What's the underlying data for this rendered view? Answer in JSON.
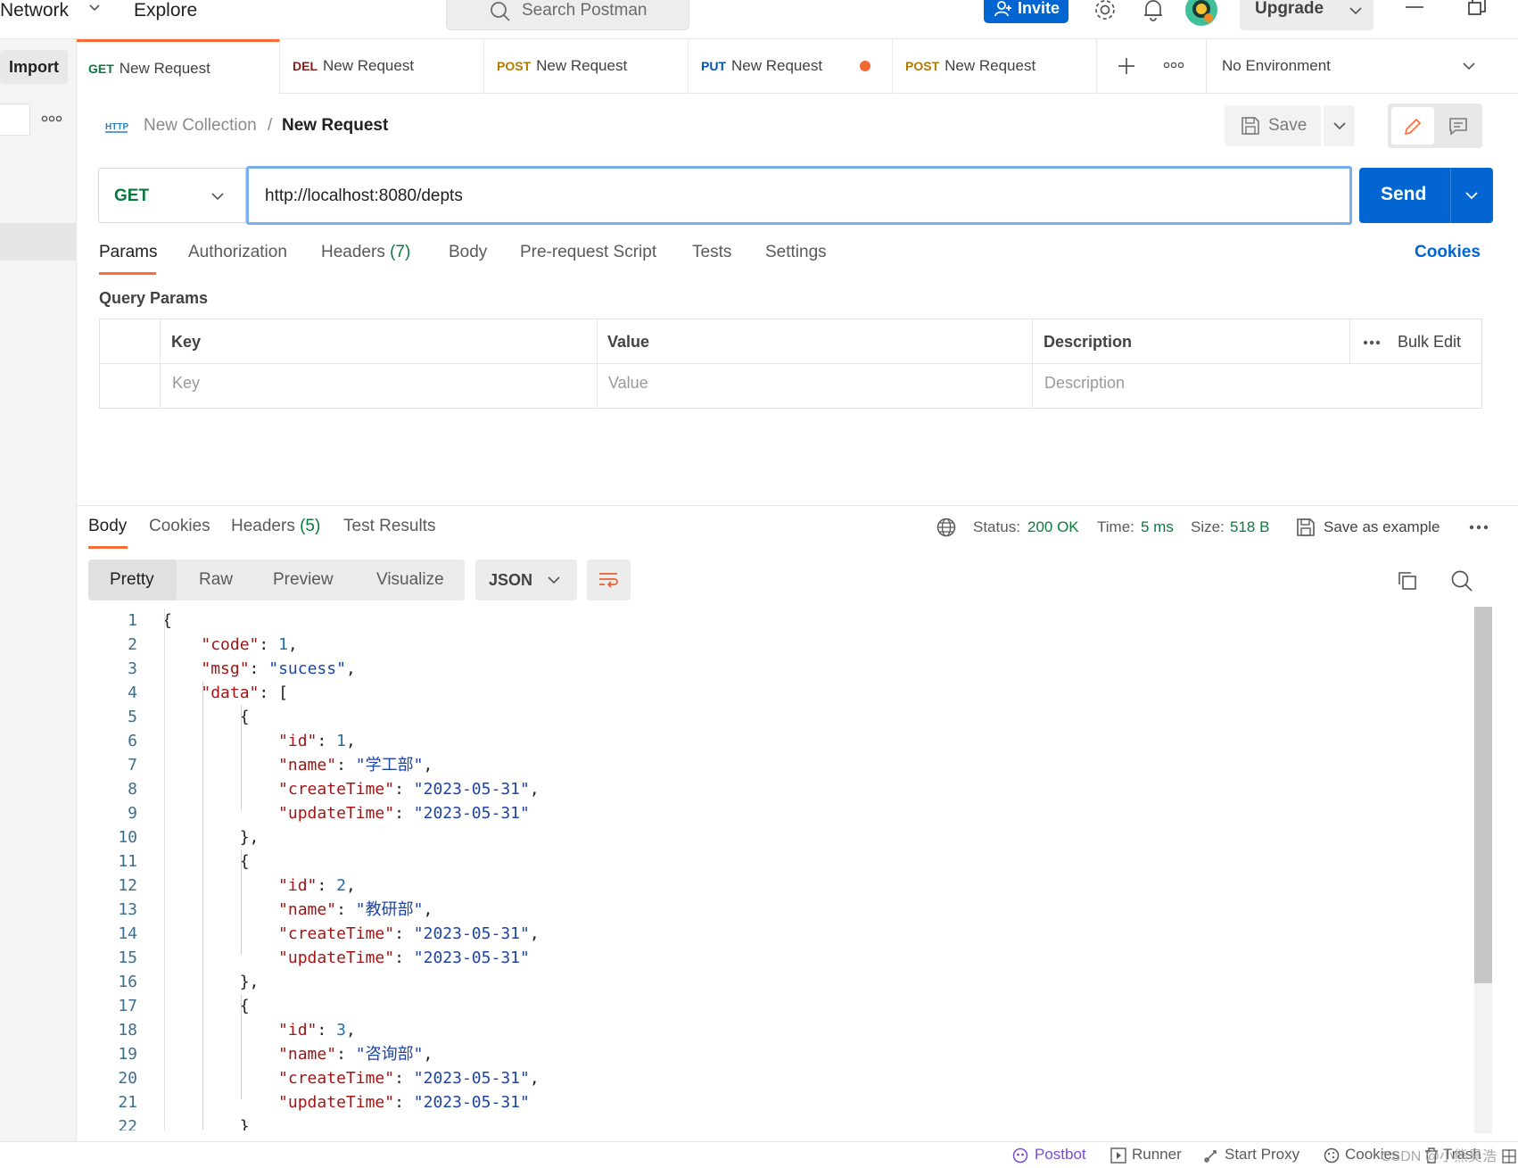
{
  "topbar": {
    "network": "Network",
    "explore": "Explore",
    "search_placeholder": "Search Postman",
    "invite": "Invite",
    "upgrade": "Upgrade"
  },
  "sidebar": {
    "import": "Import"
  },
  "tabs": [
    {
      "method": "GET",
      "method_color": "#0b7a3e",
      "label": "New Request",
      "active": true
    },
    {
      "method": "DEL",
      "method_color": "#8b1d1d",
      "label": "New Request"
    },
    {
      "method": "POST",
      "method_color": "#ad7a03",
      "label": "New Request"
    },
    {
      "method": "PUT",
      "method_color": "#0053b8",
      "label": "New Request"
    },
    {
      "method": "POST",
      "method_color": "#ad7a03",
      "label": "New Request"
    }
  ],
  "environment": "No Environment",
  "breadcrumb": {
    "collection": "New Collection",
    "separator": "/",
    "request": "New Request"
  },
  "save_label": "Save",
  "request": {
    "method": "GET",
    "url": "http://localhost:8080/depts",
    "send_label": "Send"
  },
  "request_tabs": {
    "params": "Params",
    "authorization": "Authorization",
    "headers": "Headers",
    "headers_count": "(7)",
    "body": "Body",
    "prerequest": "Pre-request Script",
    "tests": "Tests",
    "settings": "Settings",
    "cookies": "Cookies"
  },
  "query_params": {
    "title": "Query Params",
    "headers": {
      "key": "Key",
      "value": "Value",
      "description": "Description",
      "bulk_edit": "Bulk Edit"
    },
    "placeholders": {
      "key": "Key",
      "value": "Value",
      "description": "Description"
    }
  },
  "response": {
    "tabs": {
      "body": "Body",
      "cookies": "Cookies",
      "headers": "Headers",
      "headers_count": "(5)",
      "test_results": "Test Results"
    },
    "status_label": "Status:",
    "status": "200 OK",
    "time_label": "Time:",
    "time": "5 ms",
    "size_label": "Size:",
    "size": "518 B",
    "save_example": "Save as example",
    "views": {
      "pretty": "Pretty",
      "raw": "Raw",
      "preview": "Preview",
      "visualize": "Visualize"
    },
    "format": "JSON"
  },
  "code_lines": [
    [
      {
        "t": "p",
        "v": "{"
      }
    ],
    [
      {
        "t": "p",
        "v": "    "
      },
      {
        "t": "k",
        "v": "\"code\""
      },
      {
        "t": "p",
        "v": ": "
      },
      {
        "t": "n",
        "v": "1"
      },
      {
        "t": "p",
        "v": ","
      }
    ],
    [
      {
        "t": "p",
        "v": "    "
      },
      {
        "t": "k",
        "v": "\"msg\""
      },
      {
        "t": "p",
        "v": ": "
      },
      {
        "t": "s",
        "v": "\"sucess\""
      },
      {
        "t": "p",
        "v": ","
      }
    ],
    [
      {
        "t": "p",
        "v": "    "
      },
      {
        "t": "k",
        "v": "\"data\""
      },
      {
        "t": "p",
        "v": ": ["
      }
    ],
    [
      {
        "t": "p",
        "v": "        {"
      }
    ],
    [
      {
        "t": "p",
        "v": "            "
      },
      {
        "t": "k",
        "v": "\"id\""
      },
      {
        "t": "p",
        "v": ": "
      },
      {
        "t": "n",
        "v": "1"
      },
      {
        "t": "p",
        "v": ","
      }
    ],
    [
      {
        "t": "p",
        "v": "            "
      },
      {
        "t": "k",
        "v": "\"name\""
      },
      {
        "t": "p",
        "v": ": "
      },
      {
        "t": "s",
        "v": "\"学工部\""
      },
      {
        "t": "p",
        "v": ","
      }
    ],
    [
      {
        "t": "p",
        "v": "            "
      },
      {
        "t": "k",
        "v": "\"createTime\""
      },
      {
        "t": "p",
        "v": ": "
      },
      {
        "t": "s",
        "v": "\"2023-05-31\""
      },
      {
        "t": "p",
        "v": ","
      }
    ],
    [
      {
        "t": "p",
        "v": "            "
      },
      {
        "t": "k",
        "v": "\"updateTime\""
      },
      {
        "t": "p",
        "v": ": "
      },
      {
        "t": "s",
        "v": "\"2023-05-31\""
      }
    ],
    [
      {
        "t": "p",
        "v": "        },"
      }
    ],
    [
      {
        "t": "p",
        "v": "        {"
      }
    ],
    [
      {
        "t": "p",
        "v": "            "
      },
      {
        "t": "k",
        "v": "\"id\""
      },
      {
        "t": "p",
        "v": ": "
      },
      {
        "t": "n",
        "v": "2"
      },
      {
        "t": "p",
        "v": ","
      }
    ],
    [
      {
        "t": "p",
        "v": "            "
      },
      {
        "t": "k",
        "v": "\"name\""
      },
      {
        "t": "p",
        "v": ": "
      },
      {
        "t": "s",
        "v": "\"教研部\""
      },
      {
        "t": "p",
        "v": ","
      }
    ],
    [
      {
        "t": "p",
        "v": "            "
      },
      {
        "t": "k",
        "v": "\"createTime\""
      },
      {
        "t": "p",
        "v": ": "
      },
      {
        "t": "s",
        "v": "\"2023-05-31\""
      },
      {
        "t": "p",
        "v": ","
      }
    ],
    [
      {
        "t": "p",
        "v": "            "
      },
      {
        "t": "k",
        "v": "\"updateTime\""
      },
      {
        "t": "p",
        "v": ": "
      },
      {
        "t": "s",
        "v": "\"2023-05-31\""
      }
    ],
    [
      {
        "t": "p",
        "v": "        },"
      }
    ],
    [
      {
        "t": "p",
        "v": "        {"
      }
    ],
    [
      {
        "t": "p",
        "v": "            "
      },
      {
        "t": "k",
        "v": "\"id\""
      },
      {
        "t": "p",
        "v": ": "
      },
      {
        "t": "n",
        "v": "3"
      },
      {
        "t": "p",
        "v": ","
      }
    ],
    [
      {
        "t": "p",
        "v": "            "
      },
      {
        "t": "k",
        "v": "\"name\""
      },
      {
        "t": "p",
        "v": ": "
      },
      {
        "t": "s",
        "v": "\"咨询部\""
      },
      {
        "t": "p",
        "v": ","
      }
    ],
    [
      {
        "t": "p",
        "v": "            "
      },
      {
        "t": "k",
        "v": "\"createTime\""
      },
      {
        "t": "p",
        "v": ": "
      },
      {
        "t": "s",
        "v": "\"2023-05-31\""
      },
      {
        "t": "p",
        "v": ","
      }
    ],
    [
      {
        "t": "p",
        "v": "            "
      },
      {
        "t": "k",
        "v": "\"updateTime\""
      },
      {
        "t": "p",
        "v": ": "
      },
      {
        "t": "s",
        "v": "\"2023-05-31\""
      }
    ],
    [
      {
        "t": "p",
        "v": "        }"
      }
    ]
  ],
  "footer": {
    "postbot": "Postbot",
    "runner": "Runner",
    "start_proxy": "Start Proxy",
    "cookies": "Cookies",
    "trash": "Trash",
    "watermark": "CSDN @小熊昊浩"
  },
  "colors": {
    "accent": "#ff6c37",
    "primary": "#0265d2",
    "status_ok": "#0b7a3e",
    "link": "#0265d2"
  }
}
